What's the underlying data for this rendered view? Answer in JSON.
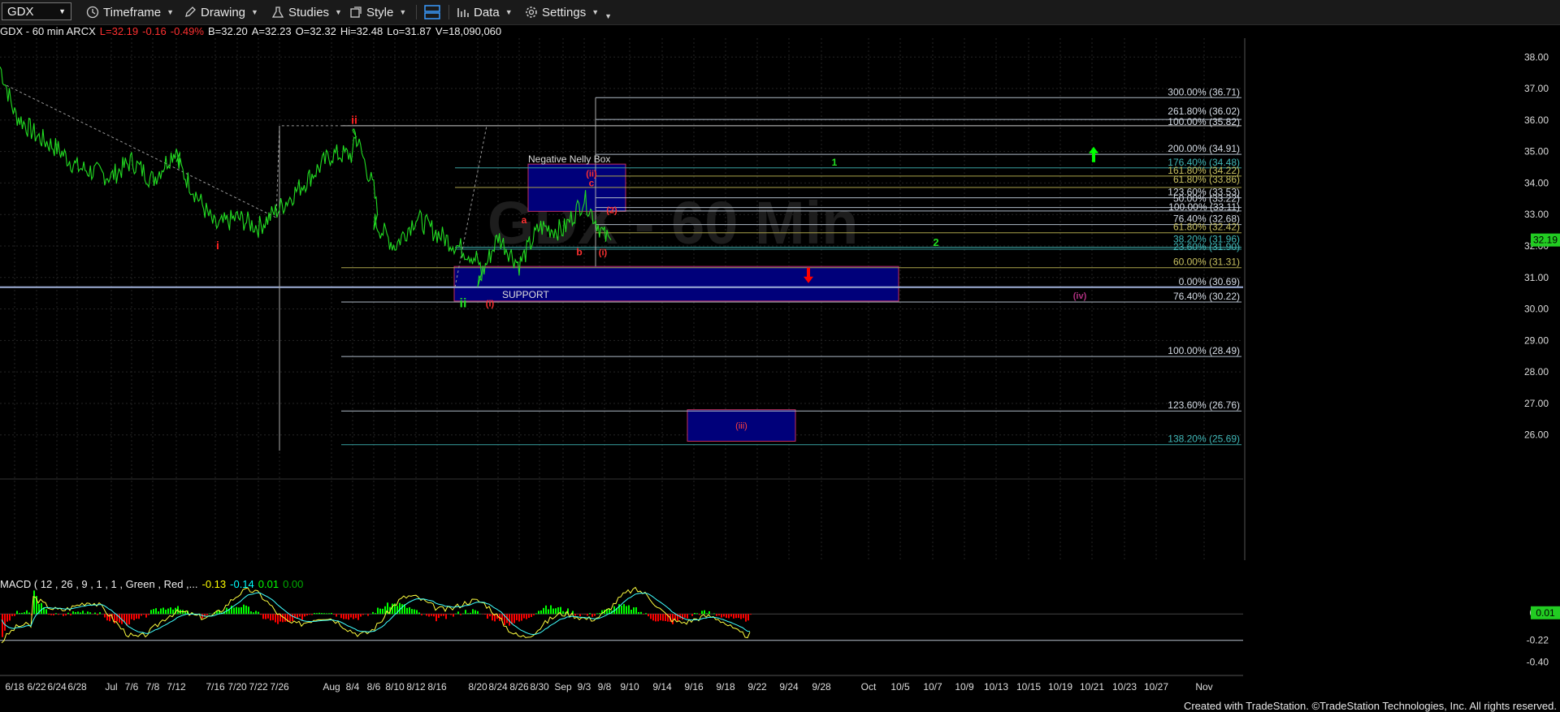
{
  "toolbar": {
    "symbol": "GDX",
    "timeframe": "Timeframe",
    "drawing": "Drawing",
    "studies": "Studies",
    "style": "Style",
    "data": "Data",
    "settings": "Settings"
  },
  "info": {
    "title": "GDX - 60 min ARCX",
    "last": "L=32.19",
    "chg": "-0.16",
    "pct": "-0.49%",
    "bid": "B=32.20",
    "ask": "A=32.23",
    "open": "O=32.32",
    "hi": "Hi=32.48",
    "lo": "Lo=31.87",
    "vol": "V=18,090,060"
  },
  "macd_label": {
    "params": "MACD ( 12 , 26 , 9 , 1 , 1 , Green , Red ,...",
    "v1": "-0.13",
    "v2": "-0.14",
    "v3": "0.01",
    "v4": "0.00"
  },
  "watermark": "GDX - 60 Min",
  "footer": "Created with TradeStation. ©TradeStation Technologies, Inc. All rights reserved.",
  "colors": {
    "price": "#22dd22",
    "up": "#00ff00",
    "down": "#ff0000",
    "box": "#000080",
    "box_border": "#cc2255"
  },
  "chart_data": {
    "type": "candlestick",
    "symbol": "GDX",
    "interval": "60 min",
    "ylim": [
      24.6,
      38.6
    ],
    "y_ticks": [
      38.0,
      37.0,
      36.0,
      35.0,
      34.0,
      33.0,
      32.0,
      31.0,
      30.0,
      29.0,
      28.0,
      27.0,
      26.0
    ],
    "x_ticks": [
      "6/18",
      "6/22",
      "6/24",
      "6/28",
      "Jul",
      "7/6",
      "7/8",
      "7/12",
      "7/16",
      "7/20",
      "7/22",
      "7/26",
      "Aug",
      "8/4",
      "8/6",
      "8/10",
      "8/12",
      "8/16",
      "8/20",
      "8/24",
      "8/26",
      "8/30",
      "Sep",
      "9/3",
      "9/8",
      "9/10",
      "9/14",
      "9/16",
      "9/18",
      "9/22",
      "9/24",
      "9/28",
      "Oct",
      "10/5",
      "10/7",
      "10/9",
      "10/13",
      "10/15",
      "10/19",
      "10/21",
      "10/23",
      "10/27",
      "Nov"
    ],
    "last_price": "32.19",
    "price_path": [
      [
        "6/18",
        37.7
      ],
      [
        "6/18",
        36.2
      ],
      [
        "6/22",
        35.5
      ],
      [
        "6/24",
        35.1
      ],
      [
        "6/28",
        34.5
      ],
      [
        "Jul",
        34.2
      ],
      [
        "7/6",
        34.7
      ],
      [
        "7/8",
        34.1
      ],
      [
        "7/12",
        35.1
      ],
      [
        "7/12",
        34.7
      ],
      [
        "7/16",
        32.6
      ],
      [
        "7/20",
        32.9
      ],
      [
        "7/22",
        32.6
      ],
      [
        "7/26",
        33.2
      ],
      [
        "Aug",
        34.9
      ],
      [
        "8/4",
        34.9
      ],
      [
        "8/4",
        35.8
      ],
      [
        "8/6",
        33.8
      ],
      [
        "8/6",
        32.8
      ],
      [
        "8/10",
        32.0
      ],
      [
        "8/12",
        32.9
      ],
      [
        "8/16",
        32.4
      ],
      [
        "8/20",
        31.6
      ],
      [
        "8/20",
        30.8
      ],
      [
        "8/24",
        32.3
      ],
      [
        "8/26",
        31.4
      ],
      [
        "8/30",
        32.6
      ],
      [
        "Sep",
        32.5
      ],
      [
        "9/3",
        33.5
      ],
      [
        "9/8",
        32.3
      ],
      [
        "9/8",
        32.19
      ]
    ],
    "fib_levels": [
      {
        "label": "300.00% (36.71)",
        "value": 36.71
      },
      {
        "label": "261.80% (36.02)",
        "value": 36.02
      },
      {
        "label": "100.00% (35.82)",
        "value": 35.82
      },
      {
        "label": "200.00% (34.91)",
        "value": 34.91
      },
      {
        "label": "176.40% (34.48)",
        "value": 34.48
      },
      {
        "label": "161.80% (34.22)",
        "value": 34.22
      },
      {
        "label": "61.80% (33.86)",
        "value": 33.86
      },
      {
        "label": "123.60% (33.53)",
        "value": 33.53
      },
      {
        "label": "50.00% (33.22)",
        "value": 33.22
      },
      {
        "label": "100.00% (33.11)",
        "value": 33.11
      },
      {
        "label": "76.40% (32.68)",
        "value": 32.68
      },
      {
        "label": "61.80% (32.42)",
        "value": 32.42
      },
      {
        "label": "38.20% (31.96)",
        "value": 31.96
      },
      {
        "label": "23.60% (31.90)",
        "value": 31.9
      },
      {
        "label": "60.00% (31.31)",
        "value": 31.31
      },
      {
        "label": "0.00% (30.69)",
        "value": 30.69
      },
      {
        "label": "76.40% (30.22)",
        "value": 30.22
      },
      {
        "label": "100.00% (28.49)",
        "value": 28.49
      },
      {
        "label": "123.60% (26.76)",
        "value": 26.76
      },
      {
        "label": "138.20% (25.69)",
        "value": 25.69
      }
    ],
    "boxes": [
      {
        "label": "Negative Nelly Box",
        "from": "8/26",
        "to": "9/8",
        "low": 33.1,
        "high": 34.6
      },
      {
        "label": "SUPPORT",
        "from": "8/16",
        "to": "10/5",
        "low": 30.25,
        "high": 31.35
      },
      {
        "label": "(iii)",
        "from": "9/16",
        "to": "9/24",
        "low": 25.8,
        "high": 26.8
      }
    ],
    "wave_labels": [
      "ii",
      "i",
      "ii",
      "(i)",
      "a",
      "b",
      "c",
      "(ii)",
      "(i)",
      "(2)",
      "1",
      "2",
      "(iv)",
      "(iii)"
    ],
    "macd": {
      "ylim": [
        -0.5,
        0.3
      ],
      "ticks": [
        0.01,
        -0.22,
        -0.4
      ],
      "values": {
        "macd": -0.13,
        "signal": -0.14,
        "hist": 0.01
      }
    }
  }
}
